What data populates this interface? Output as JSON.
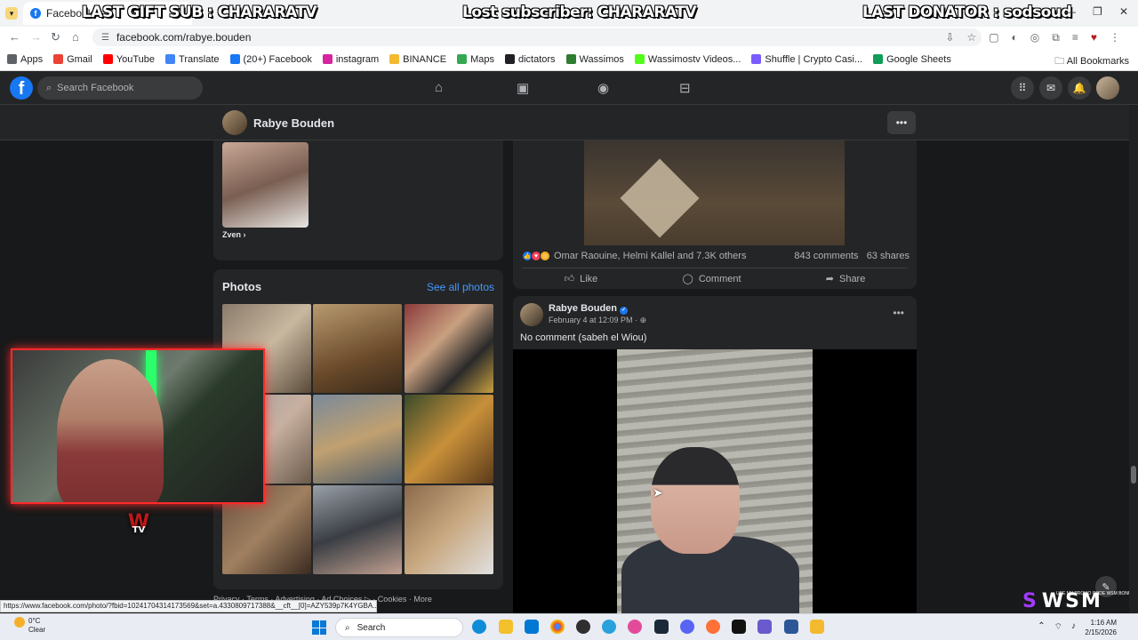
{
  "browser": {
    "tab_title": "Facebook",
    "url": "facebook.com/rabye.bouden",
    "status_url": "https://www.facebook.com/photo/?fbid=10241704314173569&set=a.4330809717388&__cft__[0]=AZY539p7K4YGBA..."
  },
  "stream_overlay": {
    "last_gift_sub": "LAST GIFT SUB : CHARARATV",
    "lost_subscriber": "Lost subscriber: CHARARATV",
    "last_donator": "LAST DONATOR : sodsoud",
    "tv_logo": "TV",
    "wsm_logo": "WSM",
    "wsm_small": "USE MY PROMO CODE WSM BONUS"
  },
  "bookmarks": [
    {
      "label": "Apps",
      "color": "#5f6368"
    },
    {
      "label": "Gmail",
      "color": "#ea4335"
    },
    {
      "label": "YouTube",
      "color": "#ff0000"
    },
    {
      "label": "Translate",
      "color": "#4285f4"
    },
    {
      "label": "(20+) Facebook",
      "color": "#1877f2"
    },
    {
      "label": "instagram",
      "color": "#d6249f"
    },
    {
      "label": "BINANCE",
      "color": "#f3ba2f"
    },
    {
      "label": "Maps",
      "color": "#34a853"
    },
    {
      "label": "dictators",
      "color": "#202124"
    },
    {
      "label": "Wassimos",
      "color": "#2e7d32"
    },
    {
      "label": "Wassimostv Videos...",
      "color": "#53fc18"
    },
    {
      "label": "Shuffle | Crypto Casi...",
      "color": "#7b5cff"
    },
    {
      "label": "Google Sheets",
      "color": "#0f9d58"
    }
  ],
  "all_bookmarks": "All Bookmarks",
  "facebook": {
    "search_placeholder": "Search Facebook",
    "profile_name": "Rabye Bouden",
    "friend_name": "Zven",
    "photos_title": "Photos",
    "see_all_photos": "See all photos",
    "footer": "Privacy · Terms · Advertising · Ad Choices ▷ · Cookies · More"
  },
  "top_post": {
    "reactions_text": "Omar Raouine, Helmi Kallel and 7.3K others",
    "comments": "843 comments",
    "shares": "63 shares",
    "like_label": "Like",
    "comment_label": "Comment",
    "share_label": "Share"
  },
  "post": {
    "author": "Rabye Bouden",
    "date": "February 4 at 12:09 PM",
    "text": "No comment (sabeh el Wiou)"
  },
  "taskbar": {
    "weather_temp": "0°C",
    "weather_desc": "Clear",
    "search_label": "Search",
    "time": "1:16 AM",
    "date": "2/15/2026"
  }
}
